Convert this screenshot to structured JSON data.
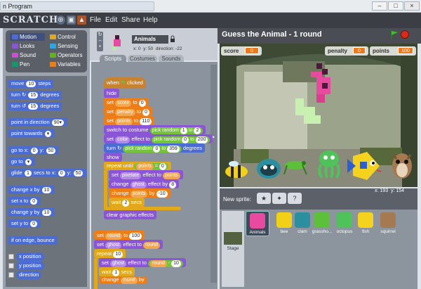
{
  "window": {
    "title": "n Program"
  },
  "menubar": {
    "logo": "SCRATCH",
    "items": [
      "File",
      "Edit",
      "Share",
      "Help"
    ]
  },
  "categories": [
    {
      "label": "Motion",
      "color": "#4a6cd4"
    },
    {
      "label": "Control",
      "color": "#e1a91a"
    },
    {
      "label": "Looks",
      "color": "#8a55d7"
    },
    {
      "label": "Sensing",
      "color": "#2ca5e2"
    },
    {
      "label": "Sound",
      "color": "#cf4ad9"
    },
    {
      "label": "Operators",
      "color": "#5cb712"
    },
    {
      "label": "Pen",
      "color": "#0e9a6c"
    },
    {
      "label": "Variables",
      "color": "#ee7d16"
    }
  ],
  "palette": {
    "move": {
      "pre": "move",
      "val": "10",
      "post": "steps"
    },
    "turn_cw": {
      "pre": "turn ↻",
      "val": "15",
      "post": "degrees"
    },
    "turn_ccw": {
      "pre": "turn ↺",
      "val": "15",
      "post": "degrees"
    },
    "point_dir": {
      "pre": "point in direction",
      "val": "90▾"
    },
    "point_towards": {
      "pre": "point towards",
      "val": "▾"
    },
    "goto_xy": {
      "pre": "go to x:",
      "x": "0",
      "mid": "y:",
      "y": "50"
    },
    "goto": {
      "pre": "go to",
      "val": "▾"
    },
    "glide": {
      "pre": "glide",
      "secs": "1",
      "mid1": "secs to x:",
      "x": "0",
      "mid2": "y:",
      "y": "50"
    },
    "change_x": {
      "pre": "change x by",
      "val": "10"
    },
    "set_x": {
      "pre": "set x to",
      "val": "0"
    },
    "change_y": {
      "pre": "change y by",
      "val": "10"
    },
    "set_y": {
      "pre": "set y to",
      "val": "0"
    },
    "bounce": "if on edge, bounce",
    "x_position": "x position",
    "y_position": "y position",
    "direction": "direction"
  },
  "sprite": {
    "name": "Animals",
    "x_label": "x:",
    "x": "0",
    "y_label": "y:",
    "y": "50",
    "dir_label": "direction:",
    "direction": "-22"
  },
  "tabs": [
    "Scripts",
    "Costumes",
    "Sounds"
  ],
  "script": {
    "when_clicked": {
      "pre": "when",
      "post": "clicked"
    },
    "hide": "hide",
    "set_score": {
      "pre": "set",
      "var": "score",
      "mid": "to",
      "val": "0"
    },
    "set_penalty": {
      "pre": "set",
      "var": "penalty",
      "mid": "to",
      "val": "0"
    },
    "set_points": {
      "pre": "set",
      "var": "points",
      "mid": "to",
      "val": "110"
    },
    "switch_costume": {
      "pre": "switch to costume",
      "op": "pick random",
      "a": "1",
      "b": "to",
      "c": "2"
    },
    "set_color": {
      "pre": "set",
      "effect": "color",
      "mid": "effect to",
      "op": "pick random",
      "a": "0",
      "b": "to",
      "c": "200"
    },
    "turn_random": {
      "pre": "turn ↻",
      "op": "pick random",
      "a": "0",
      "b": "to",
      "c": "359",
      "post": "degrees"
    },
    "show": "show",
    "repeat_until": {
      "pre": "repeat until",
      "var": "points",
      "op": "=",
      "val": "0"
    },
    "set_pixelate": {
      "pre": "set",
      "effect": "pixelate",
      "mid": "effect to",
      "var": "points"
    },
    "change_ghost": {
      "pre": "change",
      "effect": "ghost",
      "mid": "effect by",
      "val": "8"
    },
    "change_points": {
      "pre": "change",
      "var": "points",
      "mid": "by",
      "val": "-10"
    },
    "wait": {
      "pre": "wait",
      "val": "2",
      "post": "secs"
    },
    "clear_effects": "clear graphic effects",
    "set_round": {
      "pre": "set",
      "var": "round",
      "mid": "to",
      "val": "100"
    },
    "set_ghost_round": {
      "pre": "set",
      "effect": "ghost",
      "mid": "effect to",
      "var": "round"
    },
    "repeat": {
      "pre": "repeat",
      "val": "10"
    },
    "set_ghost_calc": {
      "pre": "set",
      "effect": "ghost",
      "mid": "effect to",
      "var": "round",
      "op": "-",
      "val": "10"
    },
    "wait1": {
      "pre": "wait",
      "val": "1",
      "post": "secs"
    },
    "change_round": {
      "pre": "change",
      "var": "round",
      "mid": "by"
    }
  },
  "project": {
    "title": "Guess the Animal - 1 round"
  },
  "stage": {
    "score_label": "score",
    "score": "0",
    "penalty_label": "penalty",
    "penalty": "0",
    "points_label": "points",
    "points": "100",
    "mouse_x_label": "x:",
    "mouse_x": "193",
    "mouse_y_label": "y:",
    "mouse_y": "154"
  },
  "sprite_bar": {
    "new_sprite": "New sprite:"
  },
  "sprites": [
    {
      "name": "Animals",
      "color": "#e84aa0"
    },
    {
      "name": "bee",
      "color": "#f2d018"
    },
    {
      "name": "clam",
      "color": "#2c8fa0"
    },
    {
      "name": "grassho...",
      "color": "#5cc03a"
    },
    {
      "name": "octopus",
      "color": "#4fc35a"
    },
    {
      "name": "fish",
      "color": "#f4d21e"
    },
    {
      "name": "squirrel",
      "color": "#a57a52"
    }
  ],
  "stage_thumb_label": "Stage"
}
